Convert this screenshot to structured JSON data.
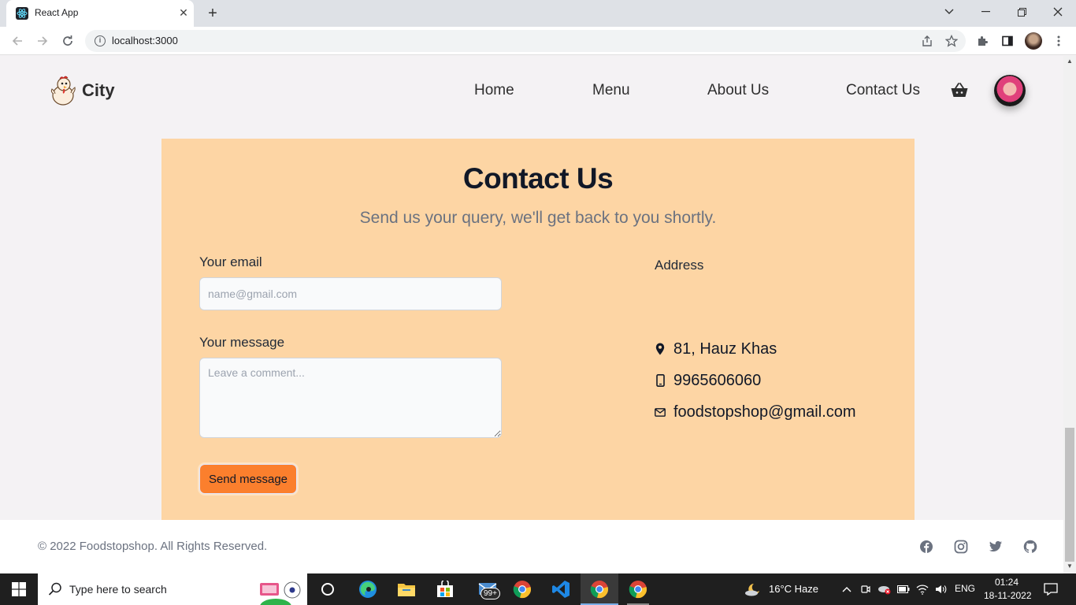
{
  "browser": {
    "tab_title": "React App",
    "url": "localhost:3000"
  },
  "header": {
    "logo_text": "City",
    "nav": [
      "Home",
      "Menu",
      "About Us",
      "Contact Us"
    ]
  },
  "contact": {
    "title": "Contact Us",
    "subtitle": "Send us your query, we'll get back to you shortly.",
    "email_label": "Your email",
    "email_placeholder": "name@gmail.com",
    "message_label": "Your message",
    "message_placeholder": "Leave a comment...",
    "send_label": "Send message",
    "address_heading": "Address",
    "address": "81, Hauz Khas",
    "phone": "9965606060",
    "email": "foodstopshop@gmail.com"
  },
  "footer": {
    "copyright": "© 2022 Foodstopshop. All Rights Reserved.",
    "social_icons": [
      "facebook-icon",
      "instagram-icon",
      "twitter-icon",
      "github-icon"
    ]
  },
  "taskbar": {
    "search_placeholder": "Type here to search",
    "mail_badge": "99+",
    "weather": "16°C  Haze",
    "language": "ENG",
    "time": "01:24",
    "date": "18-11-2022"
  },
  "colors": {
    "contact_bg": "#fdd5a4",
    "send_button": "#fb7f2d",
    "page_bg": "#f4f2f4"
  }
}
